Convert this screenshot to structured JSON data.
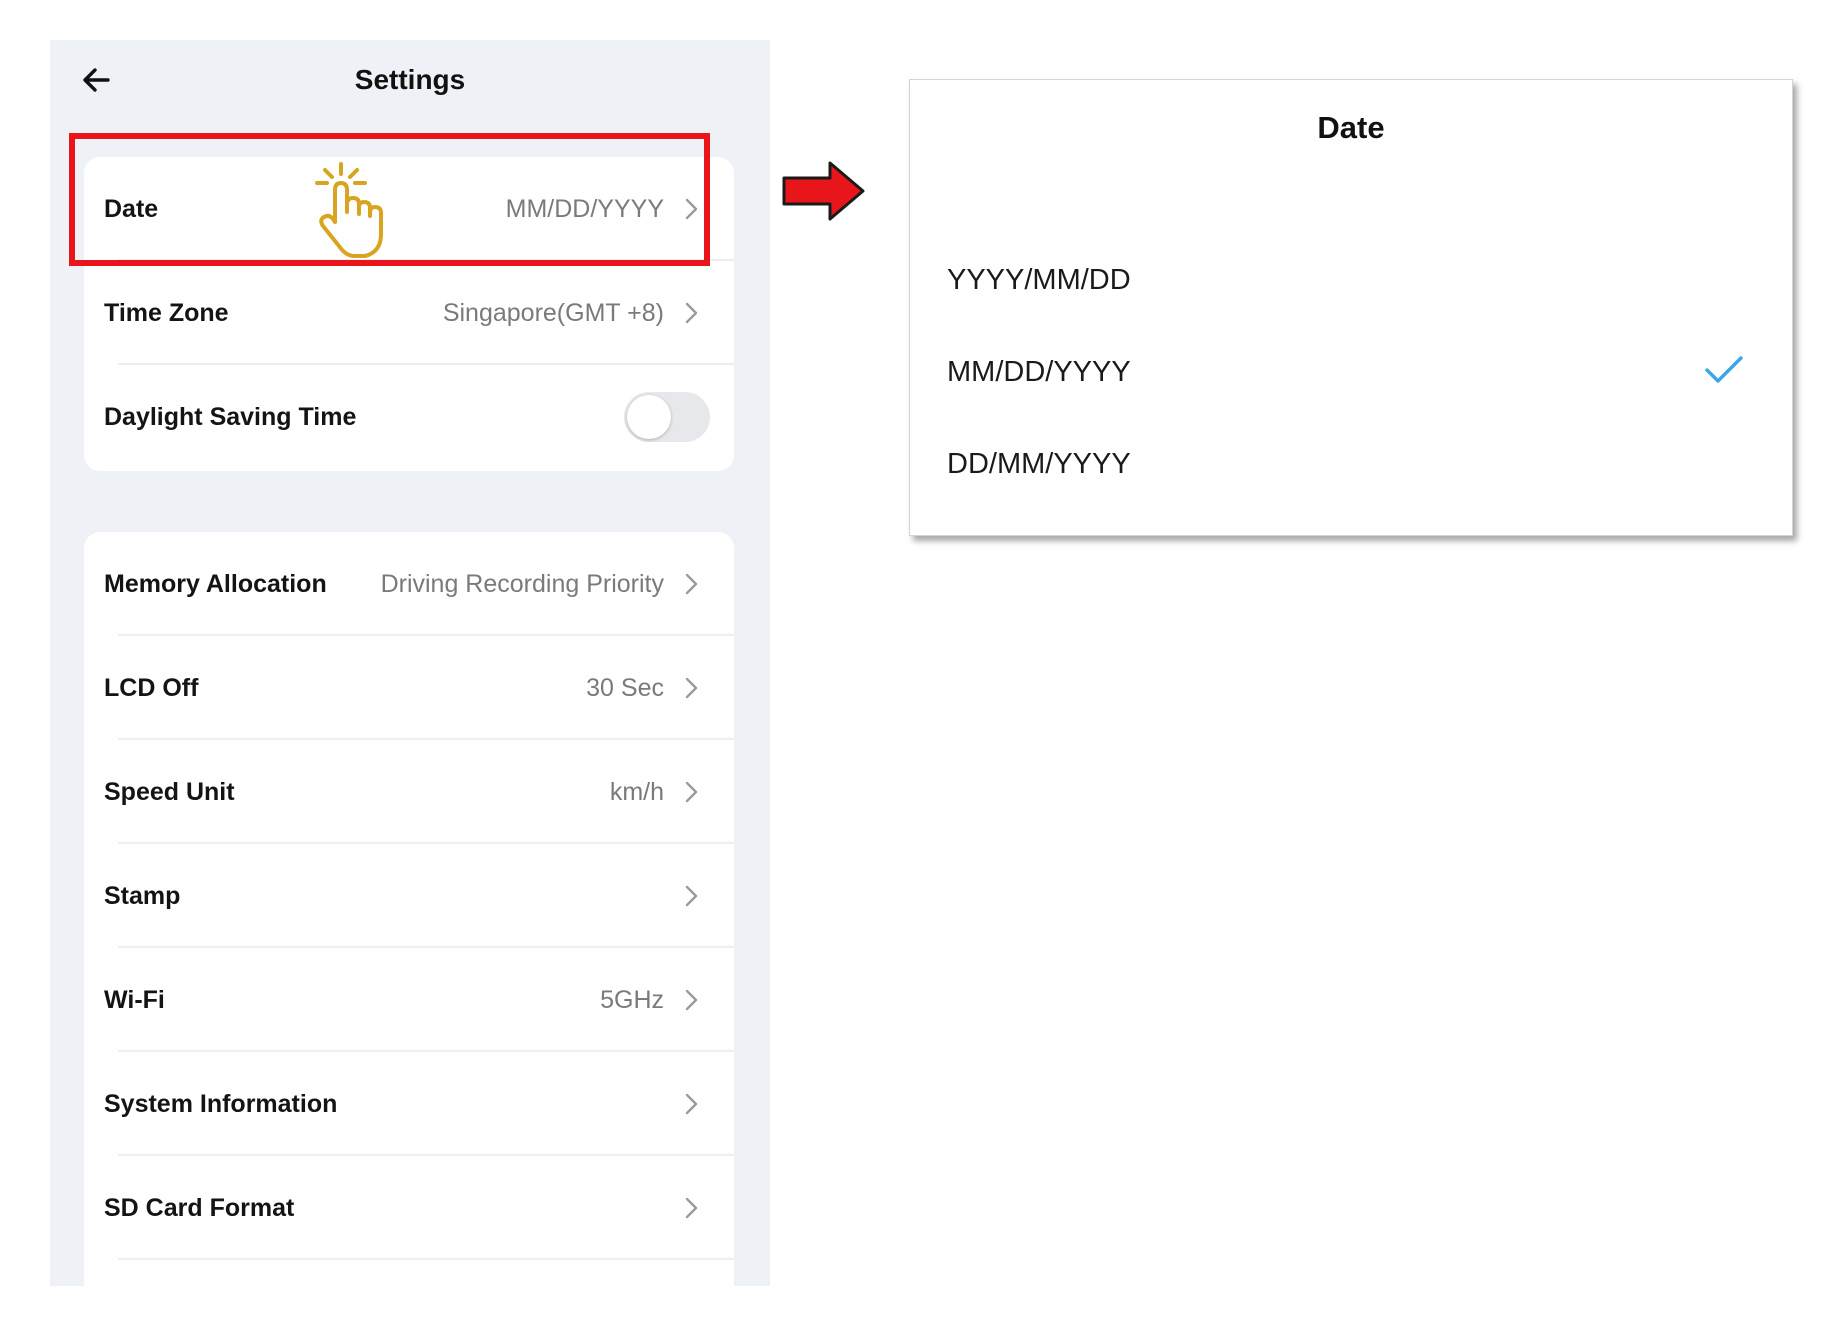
{
  "settings": {
    "title": "Settings",
    "group1": [
      {
        "label": "Date",
        "value": "MM/DD/YYYY",
        "has_chevron": true
      },
      {
        "label": "Time Zone",
        "value": "Singapore(GMT +8)",
        "has_chevron": true
      },
      {
        "label": "Daylight Saving Time",
        "toggle": false
      }
    ],
    "group2": [
      {
        "label": "Memory Allocation",
        "value": "Driving Recording Priority"
      },
      {
        "label": "LCD Off",
        "value": "30 Sec"
      },
      {
        "label": "Speed Unit",
        "value": "km/h"
      },
      {
        "label": "Stamp",
        "value": ""
      },
      {
        "label": "Wi-Fi",
        "value": "5GHz"
      },
      {
        "label": "System Information",
        "value": ""
      },
      {
        "label": "SD Card Format",
        "value": ""
      }
    ]
  },
  "date_dialog": {
    "title": "Date",
    "options": [
      "YYYY/MM/DD",
      "MM/DD/YYYY",
      "DD/MM/YYYY"
    ],
    "selected": "MM/DD/YYYY"
  },
  "icons": {
    "back": "arrow-left-icon",
    "chevron": "chevron-right-icon",
    "tap": "tap-hand-icon",
    "arrow": "red-right-arrow-icon",
    "check": "check-icon"
  },
  "colors": {
    "highlight": "#e8151b",
    "tap_hand": "#d9a420",
    "check": "#3aa6e8",
    "panel_bg": "#eef1f5",
    "value_text": "#7a7a7a"
  }
}
